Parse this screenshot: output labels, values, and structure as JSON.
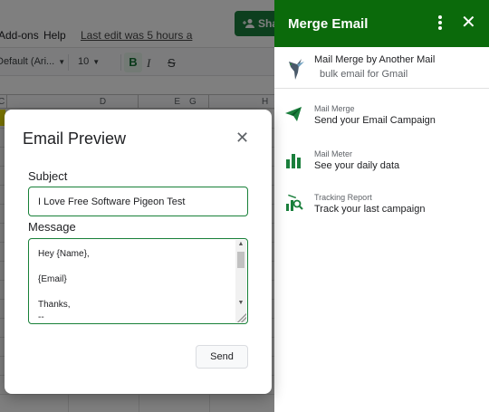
{
  "sheet": {
    "menu": {
      "addons": "Add-ons",
      "help": "Help",
      "last_edit": "Last edit was 5 hours a"
    },
    "share_label": "Sha",
    "toolbar": {
      "font": "Default (Ari...",
      "size": "10",
      "bold": "B",
      "italic": "I",
      "strike": "S"
    },
    "columns": [
      "C",
      "D",
      "E",
      "G",
      "H"
    ]
  },
  "panel": {
    "title": "Merge Email",
    "header_color": "#0b6a0b",
    "items": [
      {
        "icon": "hummingbird-logo-icon",
        "title": "Mail Merge by Another Mail",
        "subtitle": "bulk email for Gmail"
      },
      {
        "icon": "send-icon",
        "small": "Mail Merge",
        "main": "Send your Email Campaign"
      },
      {
        "icon": "bar-chart-icon",
        "small": "Mail Meter",
        "main": "See your daily data"
      },
      {
        "icon": "tracking-chart-icon",
        "small": "Tracking Report",
        "main": "Track your last campaign"
      }
    ]
  },
  "dialog": {
    "title": "Email Preview",
    "subject_label": "Subject",
    "subject_value": "I Love Free Software Pigeon Test",
    "message_label": "Message",
    "message_lines": [
      "Hey {Name},",
      "",
      "{Email}",
      "",
      "Thanks,",
      "--"
    ],
    "send_label": "Send",
    "accent_color": "#188038"
  }
}
